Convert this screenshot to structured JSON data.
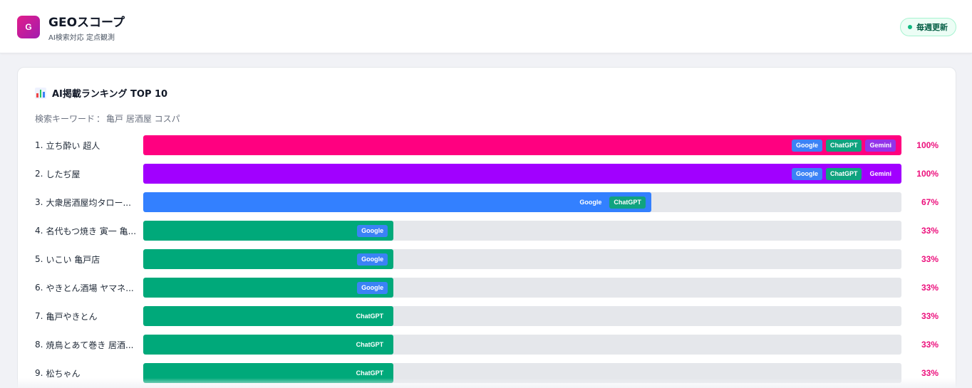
{
  "header": {
    "logo_letter": "G",
    "title": "GEOスコープ",
    "subtitle": "AI検索対応 定点観測",
    "badge_label": "毎週更新"
  },
  "ranking": {
    "title": "AI掲載ランキング TOP 10",
    "keyword_label": "検索キーワード",
    "keyword_sep": "：",
    "keyword_value": "亀戸 居酒屋 コスパ"
  },
  "colors": {
    "logo_gradient": [
      "#e11d8a",
      "#a21caf"
    ],
    "accent_pink": "#ff0080",
    "purple": "#a100ff",
    "blue": "#3380ff",
    "green": "#00a97a",
    "track": "#e5e7eb",
    "google_badge": "#3b82f6",
    "chatgpt_badge": "#10a37f",
    "gemini_badge": "#9333ea",
    "badge_dot": "#10b981",
    "percent_text": "#ec0f7c"
  },
  "icons": {
    "logo": "letter-logo-icon",
    "ranking": "bar-chart-icon",
    "status": "status-dot-icon"
  },
  "chart_data": {
    "type": "bar",
    "orientation": "horizontal",
    "title": "AI掲載ランキング TOP 10",
    "xlim": [
      0,
      100
    ],
    "unit": "%",
    "grid": false,
    "items": [
      {
        "rank": "1.",
        "name": "立ち酔い 超人",
        "value": 100,
        "percent_label": "100%",
        "bar_color": "#ff0080",
        "sources": [
          "Google",
          "ChatGPT",
          "Gemini"
        ]
      },
      {
        "rank": "2.",
        "name": "したぢ屋",
        "value": 100,
        "percent_label": "100%",
        "bar_color": "#a100ff",
        "sources": [
          "Google",
          "ChatGPT",
          "Gemini"
        ]
      },
      {
        "rank": "3.",
        "name": "大衆居酒屋均タロー...",
        "value": 67,
        "percent_label": "67%",
        "bar_color": "#3380ff",
        "sources": [
          "Google",
          "ChatGPT"
        ]
      },
      {
        "rank": "4.",
        "name": "名代もつ焼き 寅一 亀...",
        "value": 33,
        "percent_label": "33%",
        "bar_color": "#00a97a",
        "sources": [
          "Google"
        ]
      },
      {
        "rank": "5.",
        "name": "いこい 亀戸店",
        "value": 33,
        "percent_label": "33%",
        "bar_color": "#00a97a",
        "sources": [
          "Google"
        ]
      },
      {
        "rank": "6.",
        "name": "やきとん酒場 ヤマネ...",
        "value": 33,
        "percent_label": "33%",
        "bar_color": "#00a97a",
        "sources": [
          "Google"
        ]
      },
      {
        "rank": "7.",
        "name": "亀戸やきとん",
        "value": 33,
        "percent_label": "33%",
        "bar_color": "#00a97a",
        "sources": [
          "ChatGPT"
        ]
      },
      {
        "rank": "8.",
        "name": "焼鳥とあて巻き 居酒...",
        "value": 33,
        "percent_label": "33%",
        "bar_color": "#00a97a",
        "sources": [
          "ChatGPT"
        ]
      },
      {
        "rank": "9.",
        "name": "松ちゃん",
        "value": 33,
        "percent_label": "33%",
        "bar_color": "#00a97a",
        "sources": [
          "ChatGPT"
        ]
      }
    ]
  }
}
